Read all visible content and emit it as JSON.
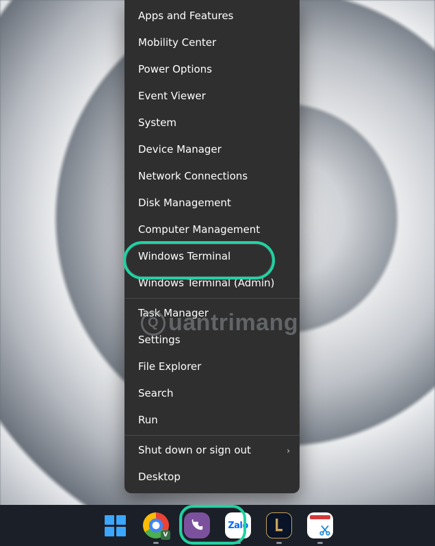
{
  "menu": {
    "groups": [
      [
        {
          "id": "apps-features",
          "label": "Apps and Features"
        },
        {
          "id": "mobility-center",
          "label": "Mobility Center"
        },
        {
          "id": "power-options",
          "label": "Power Options"
        },
        {
          "id": "event-viewer",
          "label": "Event Viewer"
        },
        {
          "id": "system",
          "label": "System"
        },
        {
          "id": "device-manager",
          "label": "Device Manager"
        },
        {
          "id": "network-connections",
          "label": "Network Connections"
        },
        {
          "id": "disk-management",
          "label": "Disk Management"
        },
        {
          "id": "computer-management",
          "label": "Computer Management"
        },
        {
          "id": "windows-terminal",
          "label": "Windows Terminal",
          "highlighted": true
        },
        {
          "id": "windows-terminal-admin",
          "label": "Windows Terminal (Admin)"
        }
      ],
      [
        {
          "id": "task-manager",
          "label": "Task Manager"
        },
        {
          "id": "settings",
          "label": "Settings"
        },
        {
          "id": "file-explorer",
          "label": "File Explorer"
        },
        {
          "id": "search",
          "label": "Search"
        },
        {
          "id": "run",
          "label": "Run"
        }
      ],
      [
        {
          "id": "shut-down",
          "label": "Shut down or sign out",
          "submenu": true
        },
        {
          "id": "desktop",
          "label": "Desktop"
        }
      ]
    ]
  },
  "watermark": {
    "text": "uantrimang"
  },
  "taskbar": {
    "items": [
      {
        "id": "start",
        "name": "start-button",
        "highlighted": true
      },
      {
        "id": "chrome",
        "name": "chrome-app",
        "running": true
      },
      {
        "id": "viber",
        "name": "viber-app",
        "running": true
      },
      {
        "id": "zalo",
        "name": "zalo-app",
        "label": "Zalo",
        "running": true
      },
      {
        "id": "lol",
        "name": "league-of-legends-app",
        "running": true
      },
      {
        "id": "snip",
        "name": "snipping-tool-app",
        "running": true
      }
    ]
  },
  "colors": {
    "highlight": "#1fd3a3",
    "menu_bg": "#2f2f2f",
    "taskbar_bg": "#1b1f27",
    "win_blue": "#3ba7ff"
  }
}
